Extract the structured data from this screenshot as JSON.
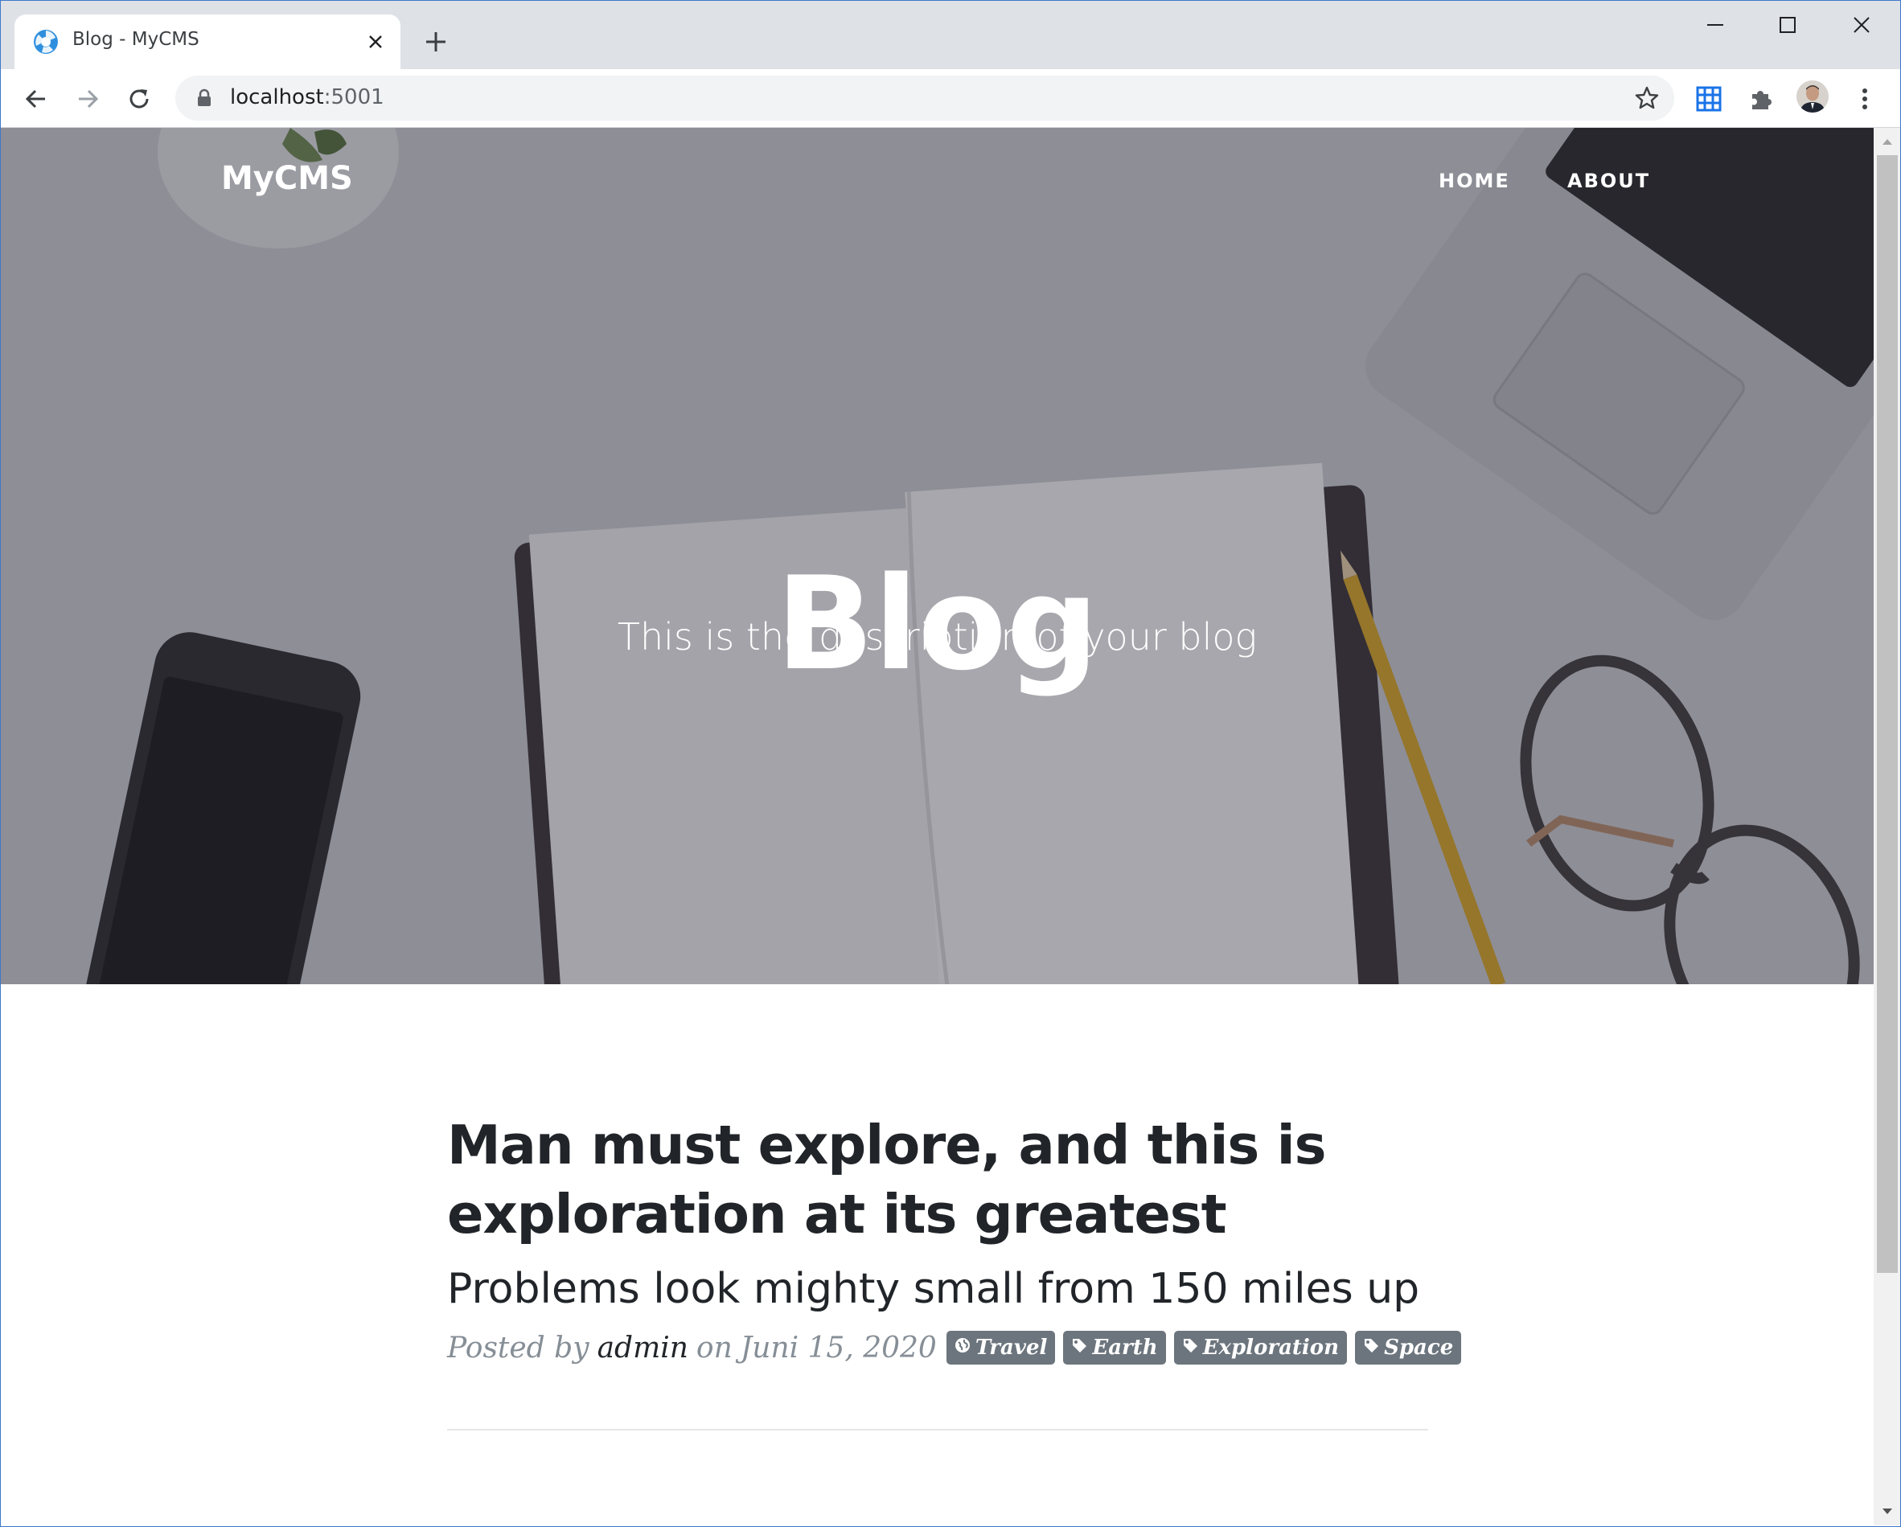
{
  "browser": {
    "tab_title": "Blog - MyCMS",
    "url_host": "localhost",
    "url_port": ":5001"
  },
  "site": {
    "brand": "MyCMS",
    "nav": [
      {
        "label": "HOME"
      },
      {
        "label": "ABOUT"
      }
    ],
    "hero_title": "Blog",
    "hero_subtitle": "This is the description of your blog"
  },
  "post": {
    "title": "Man must explore, and this is exploration at its greatest",
    "subtitle": "Problems look mighty small from 150 miles up",
    "posted_by_label": "Posted by",
    "author": "admin",
    "on_label": "on",
    "date": "Juni 15, 2020",
    "tags": [
      {
        "label": "Travel",
        "icon": "globe-icon"
      },
      {
        "label": "Earth",
        "icon": "tag-icon"
      },
      {
        "label": "Exploration",
        "icon": "tag-icon"
      },
      {
        "label": "Space",
        "icon": "tag-icon"
      }
    ]
  },
  "colors": {
    "heading": "#212529",
    "meta": "#868e96",
    "tag_bg": "#6c757d",
    "chrome": "#dee1e6"
  }
}
